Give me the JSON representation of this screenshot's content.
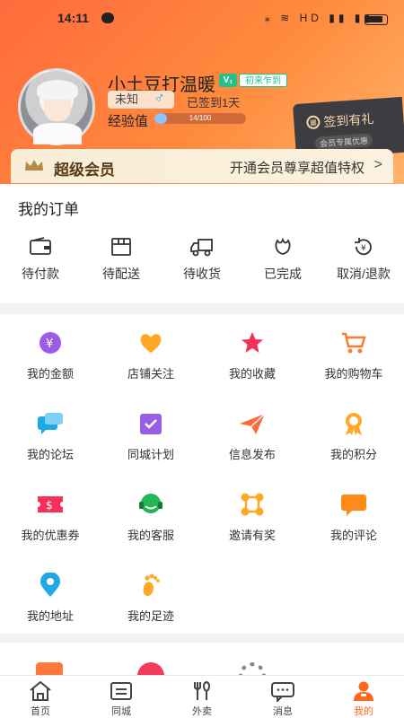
{
  "status_bar": {
    "time": "14:11",
    "indicators": "⁎ ≋ HD ▮▮ ▮▮"
  },
  "profile": {
    "username": "小土豆打温暖",
    "level_badge": "V₁",
    "level_name": "初来乍到",
    "gender_text": "未知",
    "gender_icon": "♂",
    "sign_status": "已签到1天",
    "exp_label": "经验值",
    "exp_text": "14/100",
    "exp_progress": 0.14
  },
  "sign_card": {
    "title": "签到有礼",
    "subtitle": "会员专属优惠"
  },
  "vip": {
    "title": "超级会员",
    "desc": "开通会员尊享超值特权",
    "chevron": ">"
  },
  "orders": {
    "title": "我的订单",
    "items": [
      {
        "label": "待付款",
        "icon": "wallet-icon"
      },
      {
        "label": "待配送",
        "icon": "box-icon"
      },
      {
        "label": "待收货",
        "icon": "truck-icon"
      },
      {
        "label": "已完成",
        "icon": "flower-icon"
      },
      {
        "label": "取消/退款",
        "icon": "refund-icon"
      }
    ]
  },
  "services": [
    {
      "label": "我的金额",
      "icon": "money-icon",
      "color": "#9b5de5"
    },
    {
      "label": "店铺关注",
      "icon": "heart-icon",
      "color": "#ffa826"
    },
    {
      "label": "我的收藏",
      "icon": "star-icon",
      "color": "#f5315a"
    },
    {
      "label": "我的购物车",
      "icon": "cart-icon",
      "color": "#ff7a30"
    },
    {
      "label": "我的论坛",
      "icon": "chat-icon",
      "color": "#21a9e6"
    },
    {
      "label": "同城计划",
      "icon": "calendar-icon",
      "color": "#9b5de5"
    },
    {
      "label": "信息发布",
      "icon": "send-icon",
      "color": "#ff6a3d"
    },
    {
      "label": "我的积分",
      "icon": "medal-icon",
      "color": "#ffa826"
    },
    {
      "label": "我的优惠券",
      "icon": "coupon-icon",
      "color": "#f5315a"
    },
    {
      "label": "我的客服",
      "icon": "headset-icon",
      "color": "#22b655"
    },
    {
      "label": "邀请有奖",
      "icon": "share-icon",
      "color": "#ffa826"
    },
    {
      "label": "我的评论",
      "icon": "comment-icon",
      "color": "#ff8a1a"
    },
    {
      "label": "我的地址",
      "icon": "location-icon",
      "color": "#21a9e6"
    },
    {
      "label": "我的足迹",
      "icon": "footprint-icon",
      "color": "#ffa826"
    }
  ],
  "tabs": [
    {
      "label": "首页",
      "icon": "home-icon"
    },
    {
      "label": "同城",
      "icon": "book-icon"
    },
    {
      "label": "外卖",
      "icon": "cutlery-icon"
    },
    {
      "label": "消息",
      "icon": "message-icon"
    },
    {
      "label": "我的",
      "icon": "person-icon",
      "active": true
    }
  ],
  "colors": {
    "accent": "#ff6a1a",
    "header_start": "#ff6a3d",
    "header_end": "#ffb36a"
  }
}
